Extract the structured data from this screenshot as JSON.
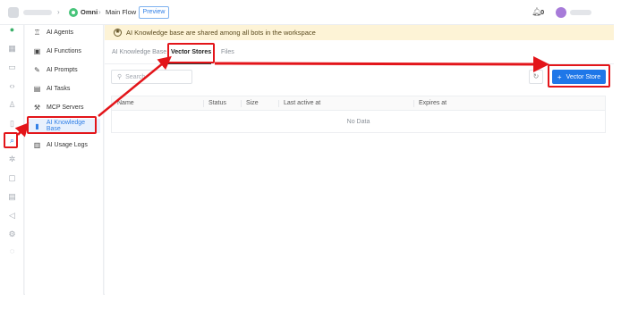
{
  "header": {
    "breadcrumb_app": "Omni",
    "breadcrumb_page": "Main Flow",
    "preview_label": "Preview",
    "notification_count": "0"
  },
  "rail": {
    "icons": [
      "chat-icon",
      "grid-icon",
      "inbox-icon",
      "code-icon",
      "user-icon",
      "book-icon",
      "ai-brain-icon",
      "settings-cog-icon",
      "message-icon",
      "storage-icon",
      "megaphone-icon",
      "gear-icon",
      "help-icon"
    ]
  },
  "sidebar": {
    "items": [
      {
        "label": "AI Agents",
        "icon": "robot-icon"
      },
      {
        "label": "AI Functions",
        "icon": "function-icon"
      },
      {
        "label": "AI Prompts",
        "icon": "magic-icon"
      },
      {
        "label": "AI Tasks",
        "icon": "task-icon"
      },
      {
        "label": "MCP Servers",
        "icon": "server-icon"
      },
      {
        "label": "AI Knowledge Base",
        "icon": "book-icon"
      },
      {
        "label": "AI Usage Logs",
        "icon": "chart-icon"
      }
    ]
  },
  "banner": {
    "text": "AI Knowledge base are shared among all bots in the workspace"
  },
  "tabs": [
    {
      "label": "AI Knowledge Base"
    },
    {
      "label": "Vector Stores"
    },
    {
      "label": "Files"
    }
  ],
  "toolbar": {
    "search_placeholder": "Search",
    "add_label": "Vector Store"
  },
  "table": {
    "columns": [
      "Name",
      "Status",
      "Size",
      "Last active at",
      "Expires at"
    ],
    "empty_text": "No Data"
  },
  "colors": {
    "accent": "#1f77e8",
    "highlight": "#e3151a",
    "banner_bg": "#fdf3d6"
  }
}
